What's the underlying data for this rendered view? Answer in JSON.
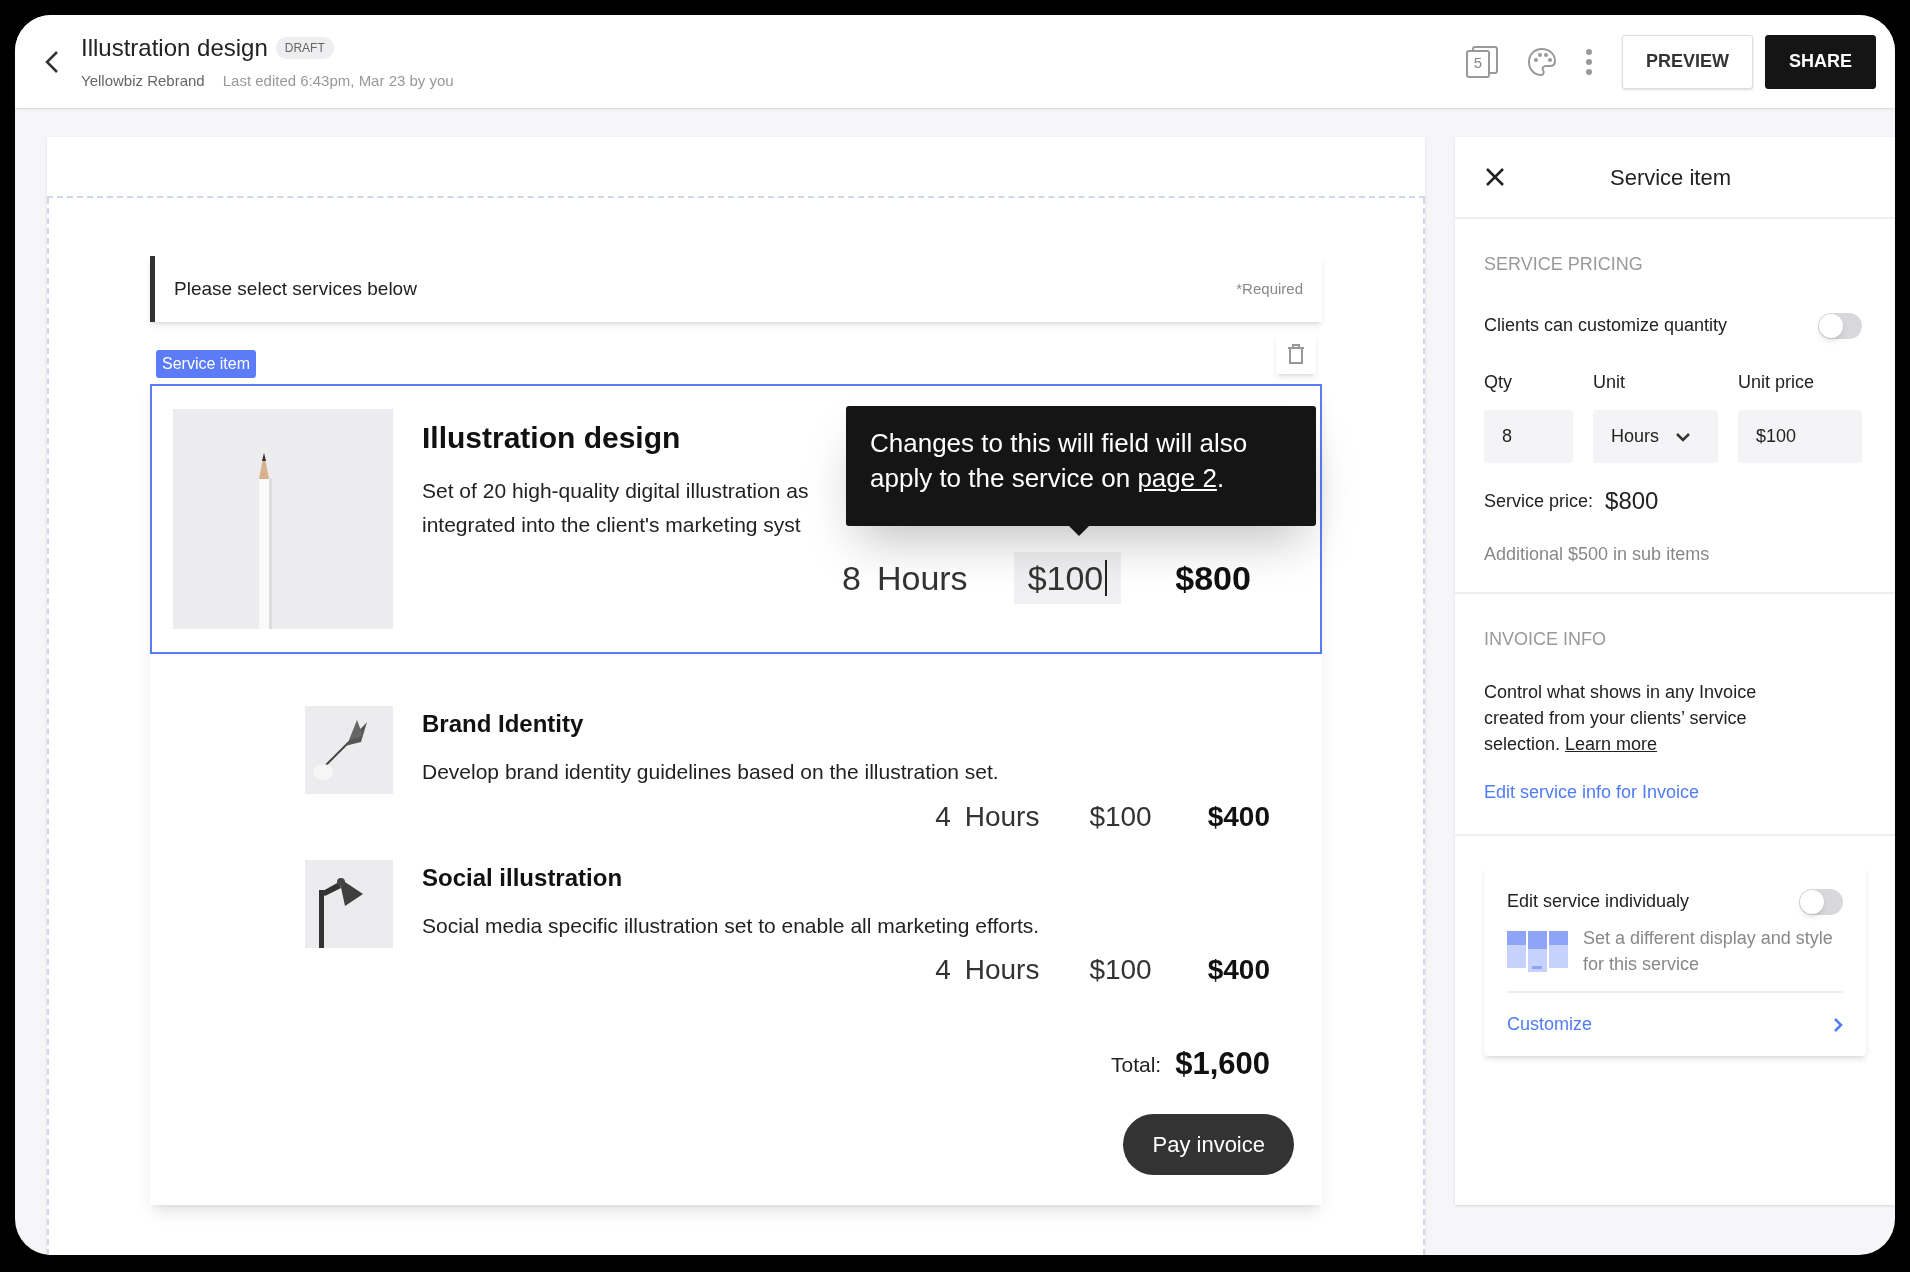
{
  "header": {
    "title": "Illustration design",
    "badge": "DRAFT",
    "project": "Yellowbiz Rebrand",
    "last_edited": "Last edited 6:43pm, Mar 23 by you",
    "page_count": "5",
    "buttons": [
      {
        "label": "PREVIEW",
        "kind": "outline"
      },
      {
        "label": "SHARE",
        "kind": "solid"
      }
    ]
  },
  "canvas": {
    "prompt": "Please select services below",
    "required": "*Required",
    "selected_tag": "Service item",
    "selected_item": {
      "title": "Illustration design",
      "description_lines": [
        "Set of 20 high-quality digital illustration as",
        "integrated into the client's marketing syst"
      ],
      "qty": "8",
      "unit": "Hours",
      "unit_price": "$100",
      "price": "$800",
      "tooltip": "Changes to this will field will also apply to the service on ",
      "tooltip_link": "page 2",
      "tooltip_end": "."
    },
    "items": [
      {
        "title": "Brand Identity",
        "description": "Develop brand identity guidelines based on the illustration set.",
        "qty": "4",
        "unit": "Hours",
        "unit_price": "$100",
        "price": "$400"
      },
      {
        "title": "Social illustration",
        "description": "Social media specific illustration set to enable all marketing efforts.",
        "qty": "4",
        "unit": "Hours",
        "unit_price": "$100",
        "price": "$400"
      }
    ],
    "total_label": "Total:",
    "total": "$1,600",
    "pay_button": "Pay invoice"
  },
  "panel": {
    "title": "Service item",
    "pricing_heading": "SERVICE PRICING",
    "customize_qty": {
      "label": "Clients can customize quantity",
      "on": false
    },
    "fields": [
      {
        "label": "Qty",
        "value": "8",
        "kind": "text"
      },
      {
        "label": "Unit",
        "value": "Hours",
        "kind": "select"
      },
      {
        "label": "Unit price",
        "value": "$100",
        "kind": "text"
      }
    ],
    "service_price_label": "Service price:",
    "service_price": "$800",
    "additional": "Additional $500 in sub items",
    "invoice_heading": "INVOICE INFO",
    "invoice_text": "Control what shows in any Invoice created from your clients’ service selection.",
    "learn_more": "Learn more",
    "edit_link": "Edit service info for Invoice",
    "individual": {
      "label": "Edit service individualy",
      "on": false,
      "description": "Set a different display and style for this service",
      "link": "Customize"
    }
  }
}
